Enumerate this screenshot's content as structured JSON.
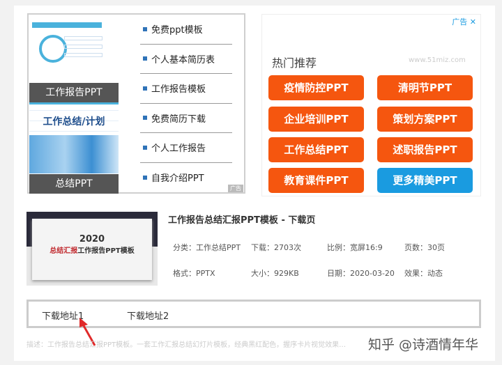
{
  "left_panel": {
    "thumbs": [
      {
        "caption": "工作报告PPT"
      },
      {
        "caption": "总结PPT",
        "headline": "工作总结/计划"
      }
    ],
    "links": [
      "免费ppt模板",
      "个人基本简历表",
      "工作报告模板",
      "免费简历下载",
      "个人工作报告",
      "自我介绍PPT"
    ],
    "ad_label": "广告"
  },
  "right_ad": {
    "ad_label": "广告",
    "close": "✕",
    "title": "热门推荐",
    "site": "www.51miz.com",
    "buttons": [
      "疫情防控PPT",
      "清明节PPT",
      "企业培训PPT",
      "策划方案PPT",
      "工作总结PPT",
      "述职报告PPT",
      "教育课件PPT",
      "更多精美PPT"
    ],
    "colors": {
      "orange": "#f5560f",
      "blue": "#1a9be0"
    }
  },
  "product": {
    "thumb_year": "2020",
    "thumb_title_red": "总结汇报",
    "thumb_title": "工作报告PPT模板",
    "title": "工作报告总结汇报PPT模板 - 下载页",
    "meta": [
      "分类：工作总结PPT",
      "下载：2703次",
      "比例：宽屏16:9",
      "页数：30页",
      "格式：PPTX",
      "大小：929KB",
      "日期：2020-03-20",
      "效果：动态"
    ]
  },
  "downloads": [
    "下载地址1",
    "下载地址2"
  ],
  "description": "描述：工作报告总结汇报PPT模板。一套工作汇报总结幻灯片模板，经典黑红配色，握序卡片视觉效果…",
  "watermark": "知乎 @诗酒情年华"
}
